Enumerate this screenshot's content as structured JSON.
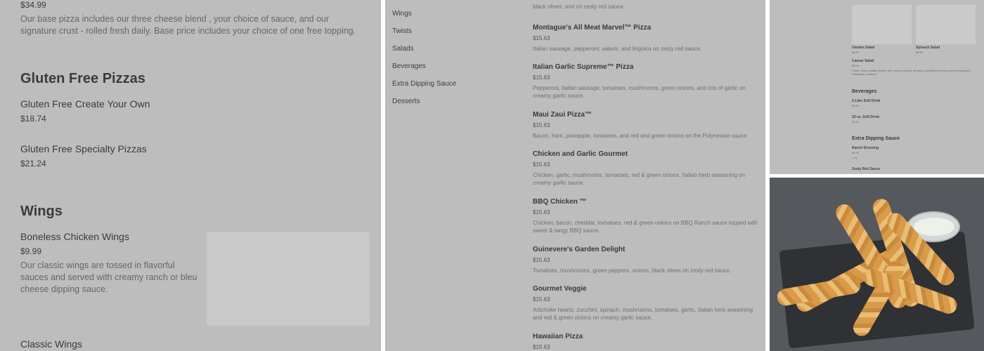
{
  "left_panel": {
    "top_price": "$34.99",
    "top_description": "Our base pizza includes our three cheese blend , your choice of sauce, and our signature crust - rolled fresh daily. Base price includes your choice of one free topping.",
    "sections": [
      {
        "title": "Gluten Free Pizzas",
        "items": [
          {
            "name": "Gluten Free Create Your Own",
            "price": "$18.74"
          },
          {
            "name": "Gluten Free Specialty Pizzas",
            "price": "$21.24"
          }
        ]
      },
      {
        "title": "Wings",
        "items": [
          {
            "name": "Boneless Chicken Wings",
            "price": "$9.99",
            "description": "Our classic wings are tossed in flavorful sauces and served with creamy ranch or bleu cheese dipping sauce."
          },
          {
            "name": "Classic Wings"
          }
        ]
      }
    ]
  },
  "middle_panel": {
    "nav_items": [
      "Wings",
      "Twists",
      "Salads",
      "Beverages",
      "Extra Dipping Sauce",
      "Desserts"
    ],
    "top_description": "black olives, and on zesty red sauce.",
    "menu_items": [
      {
        "name": "Montague's All Meat Marvel™ Pizza",
        "price": "$15.63",
        "description": "Italian sausage, pepperoni, salami, and linguica on zesty red sauce."
      },
      {
        "name": "Italian Garlic Supreme™ Pizza",
        "price": "$15.63",
        "description": "Pepperoni, Italian sausage, tomatoes, mushrooms, green onions, and lots of garlic on creamy garlic sauce."
      },
      {
        "name": "Maui Zaui Pizza™",
        "price": "$15.63",
        "description": "Bacon, ham, pineapple, tomatoes, and red and green onions on the Polynesian sauce."
      },
      {
        "name": "Chicken and Garlic Gourmet",
        "price": "$15.63",
        "description": "Chicken, garlic, mushrooms, tomatoes, red & green onions, Italian herb seasoning on creamy garlic sauce."
      },
      {
        "name": "BBQ Chicken ™",
        "price": "$15.63",
        "description": "Chicken, bacon, cheddar, tomatoes, red & green onions on BBQ Ranch sauce topped with sweet & tangy BBQ sauce."
      },
      {
        "name": "Guinevere's Garden Delight",
        "price": "$15.63",
        "description": "Tomatoes, mushrooms, green peppers, onions, black olives on zesty red sauce."
      },
      {
        "name": "Gourmet Veggie",
        "price": "$15.63",
        "description": "Artichoke hearts, zucchini, spinach, mushrooms, tomatoes, garlic, Italian herb seasoning and red & green onions on creamy garlic sauce."
      },
      {
        "name": "Hawaiian Pizza",
        "price": "$15.63"
      }
    ]
  },
  "top_right_panel": {
    "cards": [
      {
        "name": "Garden Salad",
        "price": "$9.99"
      },
      {
        "name": "Spinach Salad",
        "price": "$9.99"
      }
    ],
    "caesar": {
      "name": "Caesar Salad",
      "price": "$9.99",
      "description": "Fresh, crisp romaine lettuce with creamy Caesar dressing, shredded Romano cheese and garlic Parmesan croutons."
    },
    "sections": [
      {
        "title": "Beverages",
        "items": [
          {
            "name": "2-Liter Soft Drink",
            "price": "$3.99"
          },
          {
            "name": "20 oz. Soft Drink",
            "price": "$2.49"
          }
        ]
      },
      {
        "title": "Extra Dipping Sauce",
        "items": [
          {
            "name": "Ranch Dressing",
            "price": "$0.99",
            "note": "1 oz."
          },
          {
            "name": "Zesty Red Sauce"
          }
        ]
      }
    ]
  },
  "colors": {
    "overlay": "#bdbdbd",
    "text": "#3a3a3a",
    "muted": "#6f6f6f",
    "photo_bg": "#55585c"
  }
}
